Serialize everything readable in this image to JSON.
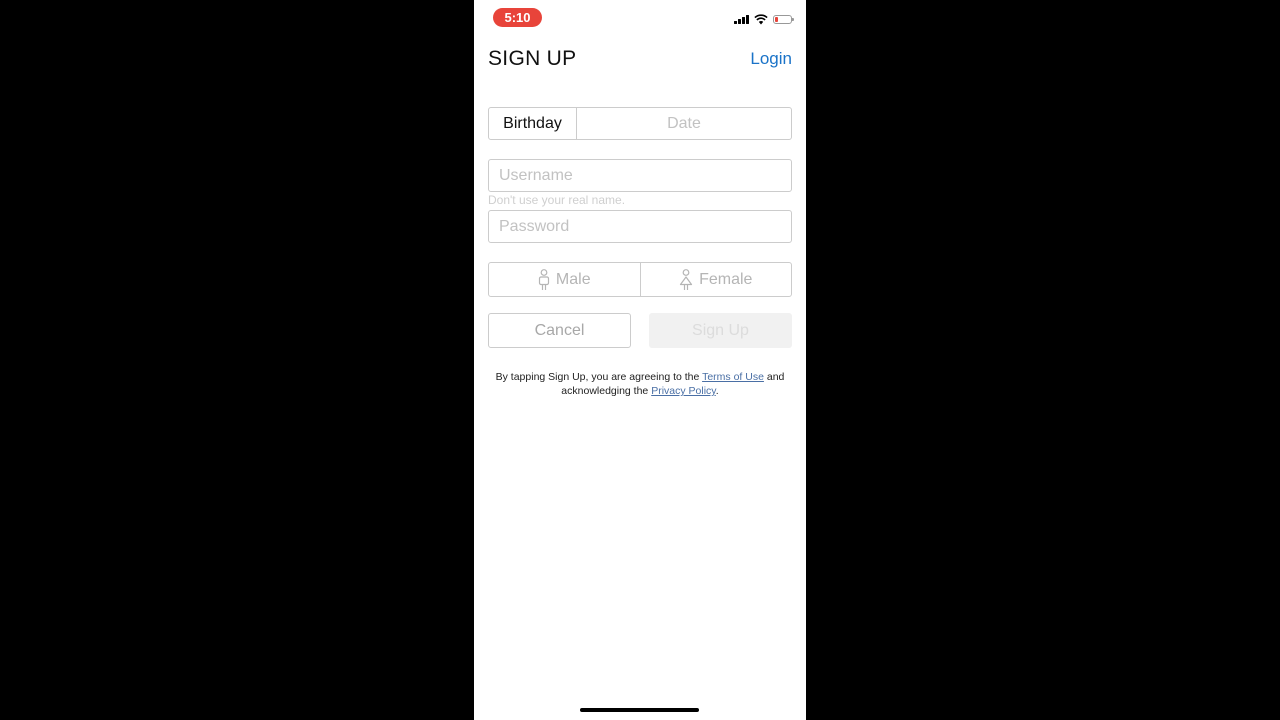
{
  "status_bar": {
    "time": "5:10",
    "icons": [
      "signal-icon",
      "wifi-icon",
      "battery-icon"
    ],
    "time_pill_color": "#e8443a",
    "battery_level": 0.15
  },
  "header": {
    "title": "SIGN UP",
    "login_label": "Login",
    "link_color": "#1a73c8"
  },
  "form": {
    "birthday_label": "Birthday",
    "date_placeholder": "Date",
    "username_placeholder": "Username",
    "username_hint": "Don't use your real name.",
    "password_placeholder": "Password",
    "gender_male": "Male",
    "gender_female": "Female",
    "male_icon": "male-person-icon",
    "female_icon": "female-person-icon"
  },
  "actions": {
    "cancel_label": "Cancel",
    "signup_label": "Sign Up",
    "signup_disabled": true
  },
  "terms": {
    "prefix": "By tapping Sign Up, you are agreeing to the ",
    "terms_link": "Terms of Use",
    "middle": " and acknowledging the ",
    "privacy_link": "Privacy Policy",
    "suffix": "."
  }
}
